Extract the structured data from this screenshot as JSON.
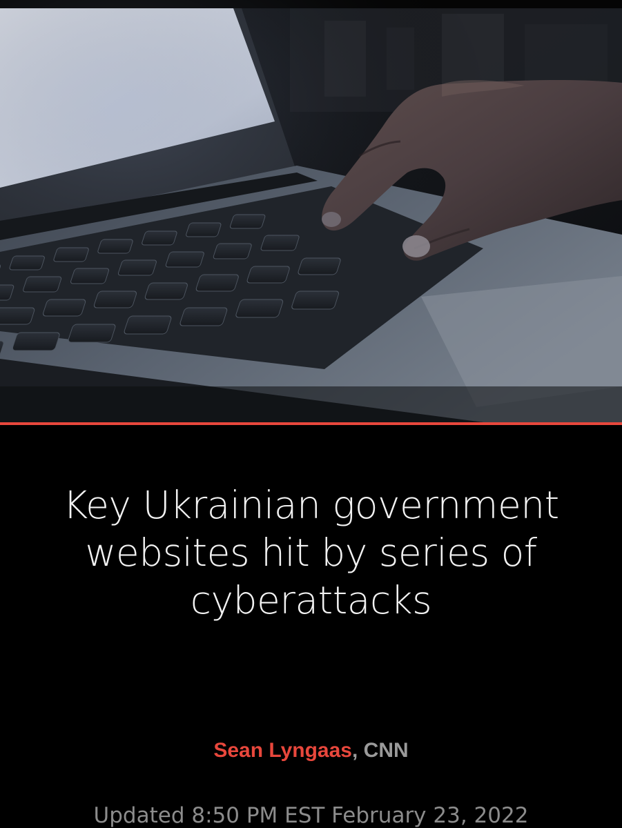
{
  "article": {
    "hero_image": {
      "description_icon": "laptop-typing-photo"
    },
    "headline": "Key Ukrainian government websites hit by series of cyberattacks",
    "byline": {
      "author": "Sean Lyngaas",
      "separator": ", ",
      "outlet": "CNN"
    },
    "updated": "Updated 8:50 PM EST February 23, 2022"
  },
  "colors": {
    "accent": "#e8473c",
    "background": "#000000",
    "headline": "#f2f2f2",
    "muted": "#8c8c8c"
  }
}
